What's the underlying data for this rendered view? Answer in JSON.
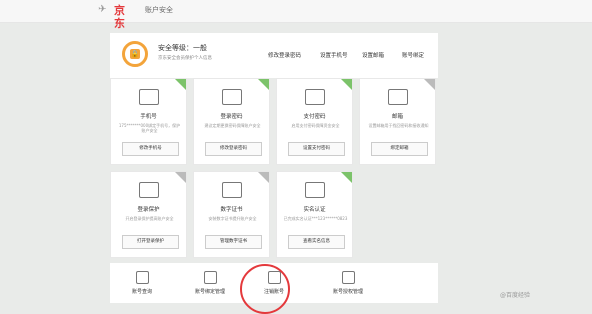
{
  "header": {
    "brand": "京东",
    "page_title": "账户安全"
  },
  "summary": {
    "level_label": "安全等级：一般",
    "level_sub": "京东安全会员保护个人信息",
    "links": [
      "修改登录密码",
      "设置手机号",
      "设置邮箱",
      "账号绑定"
    ]
  },
  "cards": [
    {
      "title": "手机号",
      "desc": "175*******000绑定手机号，保护账户安全",
      "button": "修改手机号"
    },
    {
      "title": "登录密码",
      "desc": "建议定期更换密码保障账户安全",
      "button": "修改登录密码"
    },
    {
      "title": "支付密码",
      "desc": "启用支付密码保障资金安全",
      "button": "设置支付密码"
    },
    {
      "title": "邮箱",
      "desc": "设置邮箱用于找回密码和接收通知",
      "button": "绑定邮箱"
    },
    {
      "title": "登录保护",
      "desc": "开启登录保护提高账户安全",
      "button": "打开登录保护"
    },
    {
      "title": "数字证书",
      "desc": "安装数字证书提升账户安全",
      "button": "管理数字证书"
    },
    {
      "title": "实名认证",
      "desc": "已完成实名认证***123******0823",
      "button": "查看实名信息"
    }
  ],
  "bottom_items": [
    "账号查询",
    "账号绑定管理",
    "注销账号",
    "账号授权管理"
  ],
  "watermark": "@百度经验"
}
